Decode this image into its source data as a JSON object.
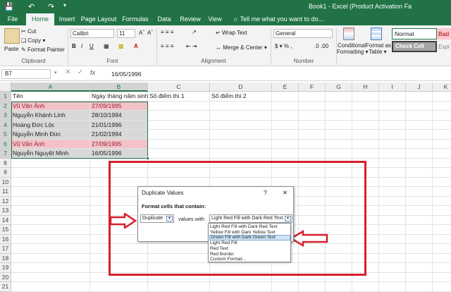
{
  "window": {
    "title": "Book1 - Excel (Product Activation Fa"
  },
  "tabs": [
    "File",
    "Home",
    "Insert",
    "Page Layout",
    "Formulas",
    "Data",
    "Review",
    "View"
  ],
  "active_tab": "Home",
  "tell_me": "Tell me what you want to do...",
  "ribbon": {
    "paste": "Paste",
    "cut": "Cut",
    "copy": "Copy",
    "format_painter": "Format Painter",
    "clipboard": "Clipboard",
    "font_name": "Calibri",
    "font_size": "11",
    "font": "Font",
    "wrap_text": "Wrap Text",
    "merge_center": "Merge & Center",
    "alignment": "Alignment",
    "number_format": "General",
    "number": "Number",
    "conditional_formatting_1": "Conditional",
    "conditional_formatting_2": "Formatting",
    "format_as_table_1": "Format as",
    "format_as_table_2": "Table",
    "style_normal": "Normal",
    "style_bad": "Bad",
    "style_check_cell": "Check Cell",
    "style_explanatory": "Expl"
  },
  "formula_bar": {
    "name_box": "B7",
    "value": "16/05/1996"
  },
  "columns": [
    "A",
    "B",
    "C",
    "D",
    "E",
    "F",
    "G",
    "H",
    "I",
    "J",
    "K"
  ],
  "rows": [
    "1",
    "2",
    "3",
    "4",
    "5",
    "6",
    "7",
    "8",
    "9",
    "10",
    "11",
    "12",
    "13",
    "14",
    "15",
    "16",
    "17",
    "18",
    "19",
    "20",
    "21"
  ],
  "cells": {
    "A1": "Tên",
    "B1": "Ngày tháng năm sinh",
    "C1": "Số điểm thi 1",
    "D1": "Số điểm thi 2",
    "A2": "Vũ Văn Ánh",
    "B2": "27/09/1995",
    "A3": "Nguyễn Khánh Linh",
    "B3": "28/10/1994",
    "A4": "Hoàng Đức Lộc",
    "B4": "21/01/1996",
    "A5": "Nguyễn Minh Đức",
    "B5": "21/02/1994",
    "A6": "Vũ Văn Ánh",
    "B6": "27/09/1995",
    "A7": "Nguyễn Nguyệt Minh",
    "B7": "16/05/1996"
  },
  "dialog": {
    "title": "Duplicate Values",
    "help": "?",
    "close": "✕",
    "prompt": "Format cells that contain:",
    "type_value": "Duplicate",
    "values_with": "values with",
    "format_value": "Light Red Fill with Dark Red Text",
    "options": [
      "Light Red Fill with Dark Red Text",
      "Yellow Fill with Dark Yellow Text",
      "Green Fill with Dark Green Text",
      "Light Red Fill",
      "Red Text",
      "Red Border",
      "Custom Format..."
    ],
    "highlighted_option_index": 2
  },
  "colors": {
    "excel_green": "#217346",
    "annotation_red": "#d6202c",
    "dup_fill": "#f1c3c9",
    "dup_text": "#9c1c2b"
  }
}
